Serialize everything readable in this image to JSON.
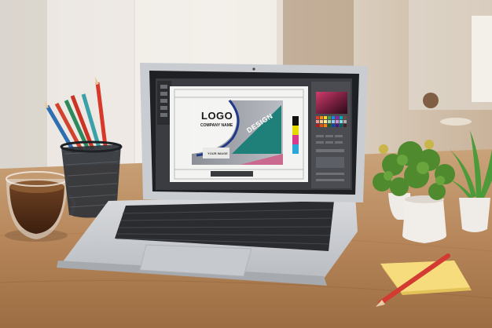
{
  "scene": {
    "description_colors": {
      "wall": "#e9e4de",
      "desk": "#b98a5c",
      "laptop_silver": "#d4d6d9",
      "screen_dark": "#26272b",
      "teal": "#1f7f79",
      "pink": "#c96a8e"
    }
  },
  "screen": {
    "logo_title": "LOGO",
    "logo_subtitle": "COMPANY NAME",
    "image_placeholder": "YOUR IMAGE",
    "design_word": "DESIGN",
    "swatch_colors": [
      "#101010",
      "#e4d900",
      "#d63b8c",
      "#2aa7d8"
    ]
  }
}
